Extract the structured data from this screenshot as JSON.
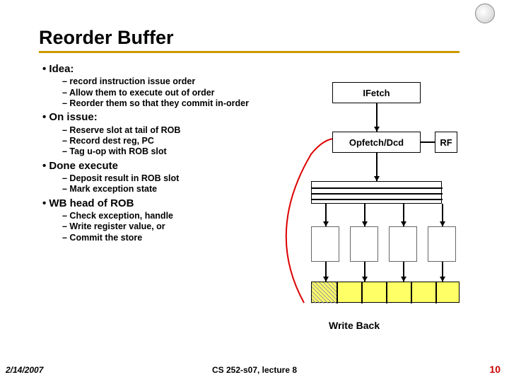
{
  "title": "Reorder Buffer",
  "bullets": {
    "idea": {
      "heading": "• Idea:",
      "items": [
        "– record instruction issue order",
        "– Allow them to execute out of order",
        "– Reorder them so that they commit in-order"
      ]
    },
    "onissue": {
      "heading": "• On issue:",
      "items": [
        "– Reserve slot at tail of ROB",
        "– Record dest reg, PC",
        "– Tag u-op with ROB slot"
      ]
    },
    "doneexec": {
      "heading": "• Done execute",
      "items": [
        "– Deposit result in ROB slot",
        "– Mark exception state"
      ]
    },
    "wbhead": {
      "heading": "• WB head of ROB",
      "items": [
        "– Check exception, handle",
        "– Write register value, or",
        "– Commit the store"
      ]
    }
  },
  "diagram": {
    "ifetch": "IFetch",
    "opfetch": "Opfetch/Dcd",
    "rf": "RF",
    "writeback": "Write Back"
  },
  "footer": {
    "date": "2/14/2007",
    "center": "CS 252-s07, lecture 8",
    "page": "10"
  }
}
